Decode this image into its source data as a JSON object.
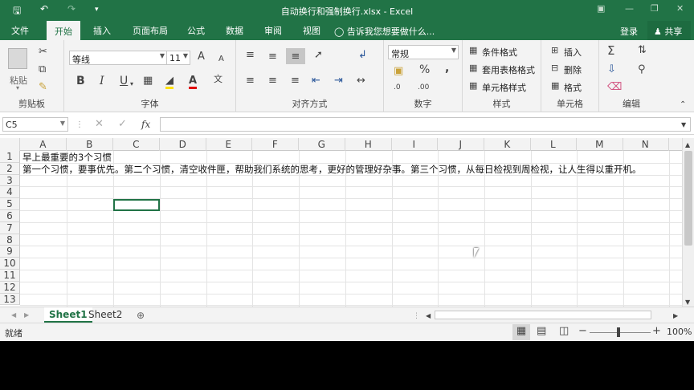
{
  "window": {
    "title": "自动换行和强制换行.xlsx - Excel"
  },
  "qat": {
    "save_icon": "save-icon",
    "undo_icon": "undo-icon",
    "redo_icon": "redo-icon",
    "customize_icon": "customize-qat-icon"
  },
  "tabs": [
    "文件",
    "开始",
    "插入",
    "页面布局",
    "公式",
    "数据",
    "审阅",
    "视图"
  ],
  "active_tab": "开始",
  "tell_me": "告诉我您想要做什么...",
  "account": {
    "login": "登录",
    "share": "共享"
  },
  "ribbon": {
    "clipboard": {
      "label": "剪贴板",
      "paste": "粘贴"
    },
    "font": {
      "label": "字体",
      "name": "等线",
      "size": "11",
      "bold": "B",
      "italic": "I",
      "underline": "U",
      "grow": "A",
      "shrink": "A"
    },
    "alignment": {
      "label": "对齐方式"
    },
    "number": {
      "label": "数字",
      "format": "常规",
      "percent": "%",
      "comma": ","
    },
    "styles": {
      "label": "样式",
      "conditional": "条件格式",
      "table": "套用表格格式",
      "cell_styles": "单元格样式"
    },
    "cells": {
      "label": "单元格",
      "insert": "插入",
      "delete": "删除",
      "format": "格式"
    },
    "editing": {
      "label": "编辑"
    }
  },
  "formula_bar": {
    "name_box": "C5",
    "fx": "fx",
    "content": ""
  },
  "columns": [
    "A",
    "B",
    "C",
    "D",
    "E",
    "F",
    "G",
    "H",
    "I",
    "J",
    "K",
    "L",
    "M",
    "N"
  ],
  "rows": [
    "1",
    "2",
    "3",
    "4",
    "5",
    "6",
    "7",
    "8",
    "9",
    "10",
    "11",
    "12",
    "13"
  ],
  "cells": {
    "A1": "早上最重要的3个习惯",
    "A2": "第一个习惯，要事优先。第二个习惯，清空收件匣，帮助我们系统的思考，更好的管理好杂事。第三个习惯，从每日检视到周检视，让人生得以重开机。"
  },
  "sheets": [
    "Sheet1",
    "Sheet2"
  ],
  "active_sheet": "Sheet1",
  "status": {
    "mode": "就绪",
    "zoom": "100%"
  },
  "colors": {
    "excel_green": "#217346",
    "ribbon_bg": "#f3f3f3"
  }
}
